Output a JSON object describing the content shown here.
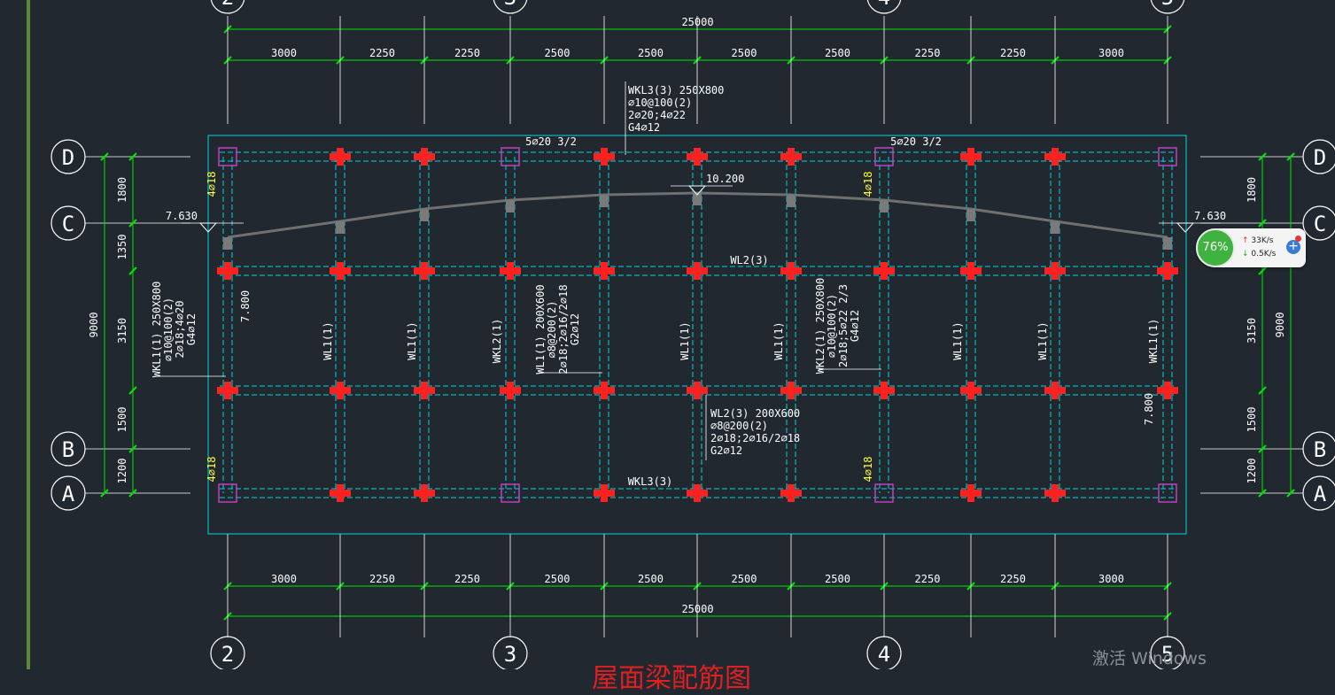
{
  "drawing": {
    "title": "屋面梁配筋图",
    "grid_top": [
      "2",
      "3",
      "4",
      "5"
    ],
    "grid_side": [
      "D",
      "C",
      "B",
      "A"
    ],
    "overall_width": "25000",
    "bay_dims": [
      "3000",
      "2250",
      "2250",
      "2500",
      "2500",
      "2500",
      "2500",
      "2250",
      "2250",
      "3000"
    ],
    "side_dims": [
      "1800",
      "1350",
      "3150",
      "1500",
      "1200"
    ],
    "overall_depth": "9000",
    "elevations": [
      "7.630",
      "10.200",
      "7.630",
      "7.800",
      "7.800"
    ],
    "top_bar_notes": [
      "5⌀20 3/2",
      "5⌀20 3/2"
    ],
    "corner_bars": [
      "4⌀18",
      "4⌀18",
      "4⌀18",
      "4⌀18"
    ],
    "beam_labels": {
      "wl2_mid": "WL2(3)",
      "wkl3_bottom": "WKL3(3)",
      "wl1_a": "WL1(1)",
      "wl1_b": "WL1(1)",
      "wkl2_a": "WKL2(1)",
      "wl1_c": "WL1(1)",
      "wl1_d": "WL1(1)",
      "wl1_e": "WL1(1)",
      "wl1_f": "WL1(1)",
      "wkl1_right": "WKL1(1)"
    },
    "callouts": {
      "wkl3_top": [
        "WKL3(3) 250X800",
        "⌀10@100(2)",
        "2⌀20;4⌀22",
        "G4⌀12"
      ],
      "wkl1_left": [
        "WKL1(1) 250X800",
        "⌀10@100(2)",
        "2⌀18;4⌀20",
        "G4⌀12"
      ],
      "wl1_mid": [
        "WL1(1) 200X600",
        "⌀8@200(2)",
        "2⌀18;2⌀16/2⌀18",
        "G2⌀12"
      ],
      "wkl2_mid": [
        "WKL2(1) 250X800",
        "⌀10@100(2)",
        "2⌀18;5⌀22 2/3",
        "G4⌀12"
      ],
      "wl2_detail": [
        "WL2(3) 200X600",
        "⌀8@200(2)",
        "2⌀18;2⌀16/2⌀18",
        "G2⌀12"
      ]
    }
  },
  "network_widget": {
    "percent": "76%",
    "upload": "33K/s",
    "download": "0.5K/s"
  },
  "watermark": "激活 Windows",
  "colors": {
    "background": "#212830",
    "dim": "#00e600",
    "outline": "#00d8d8",
    "rebar": "#ff2020",
    "text": "#ffffff",
    "note": "#ffff40",
    "column": "#c040c0"
  }
}
